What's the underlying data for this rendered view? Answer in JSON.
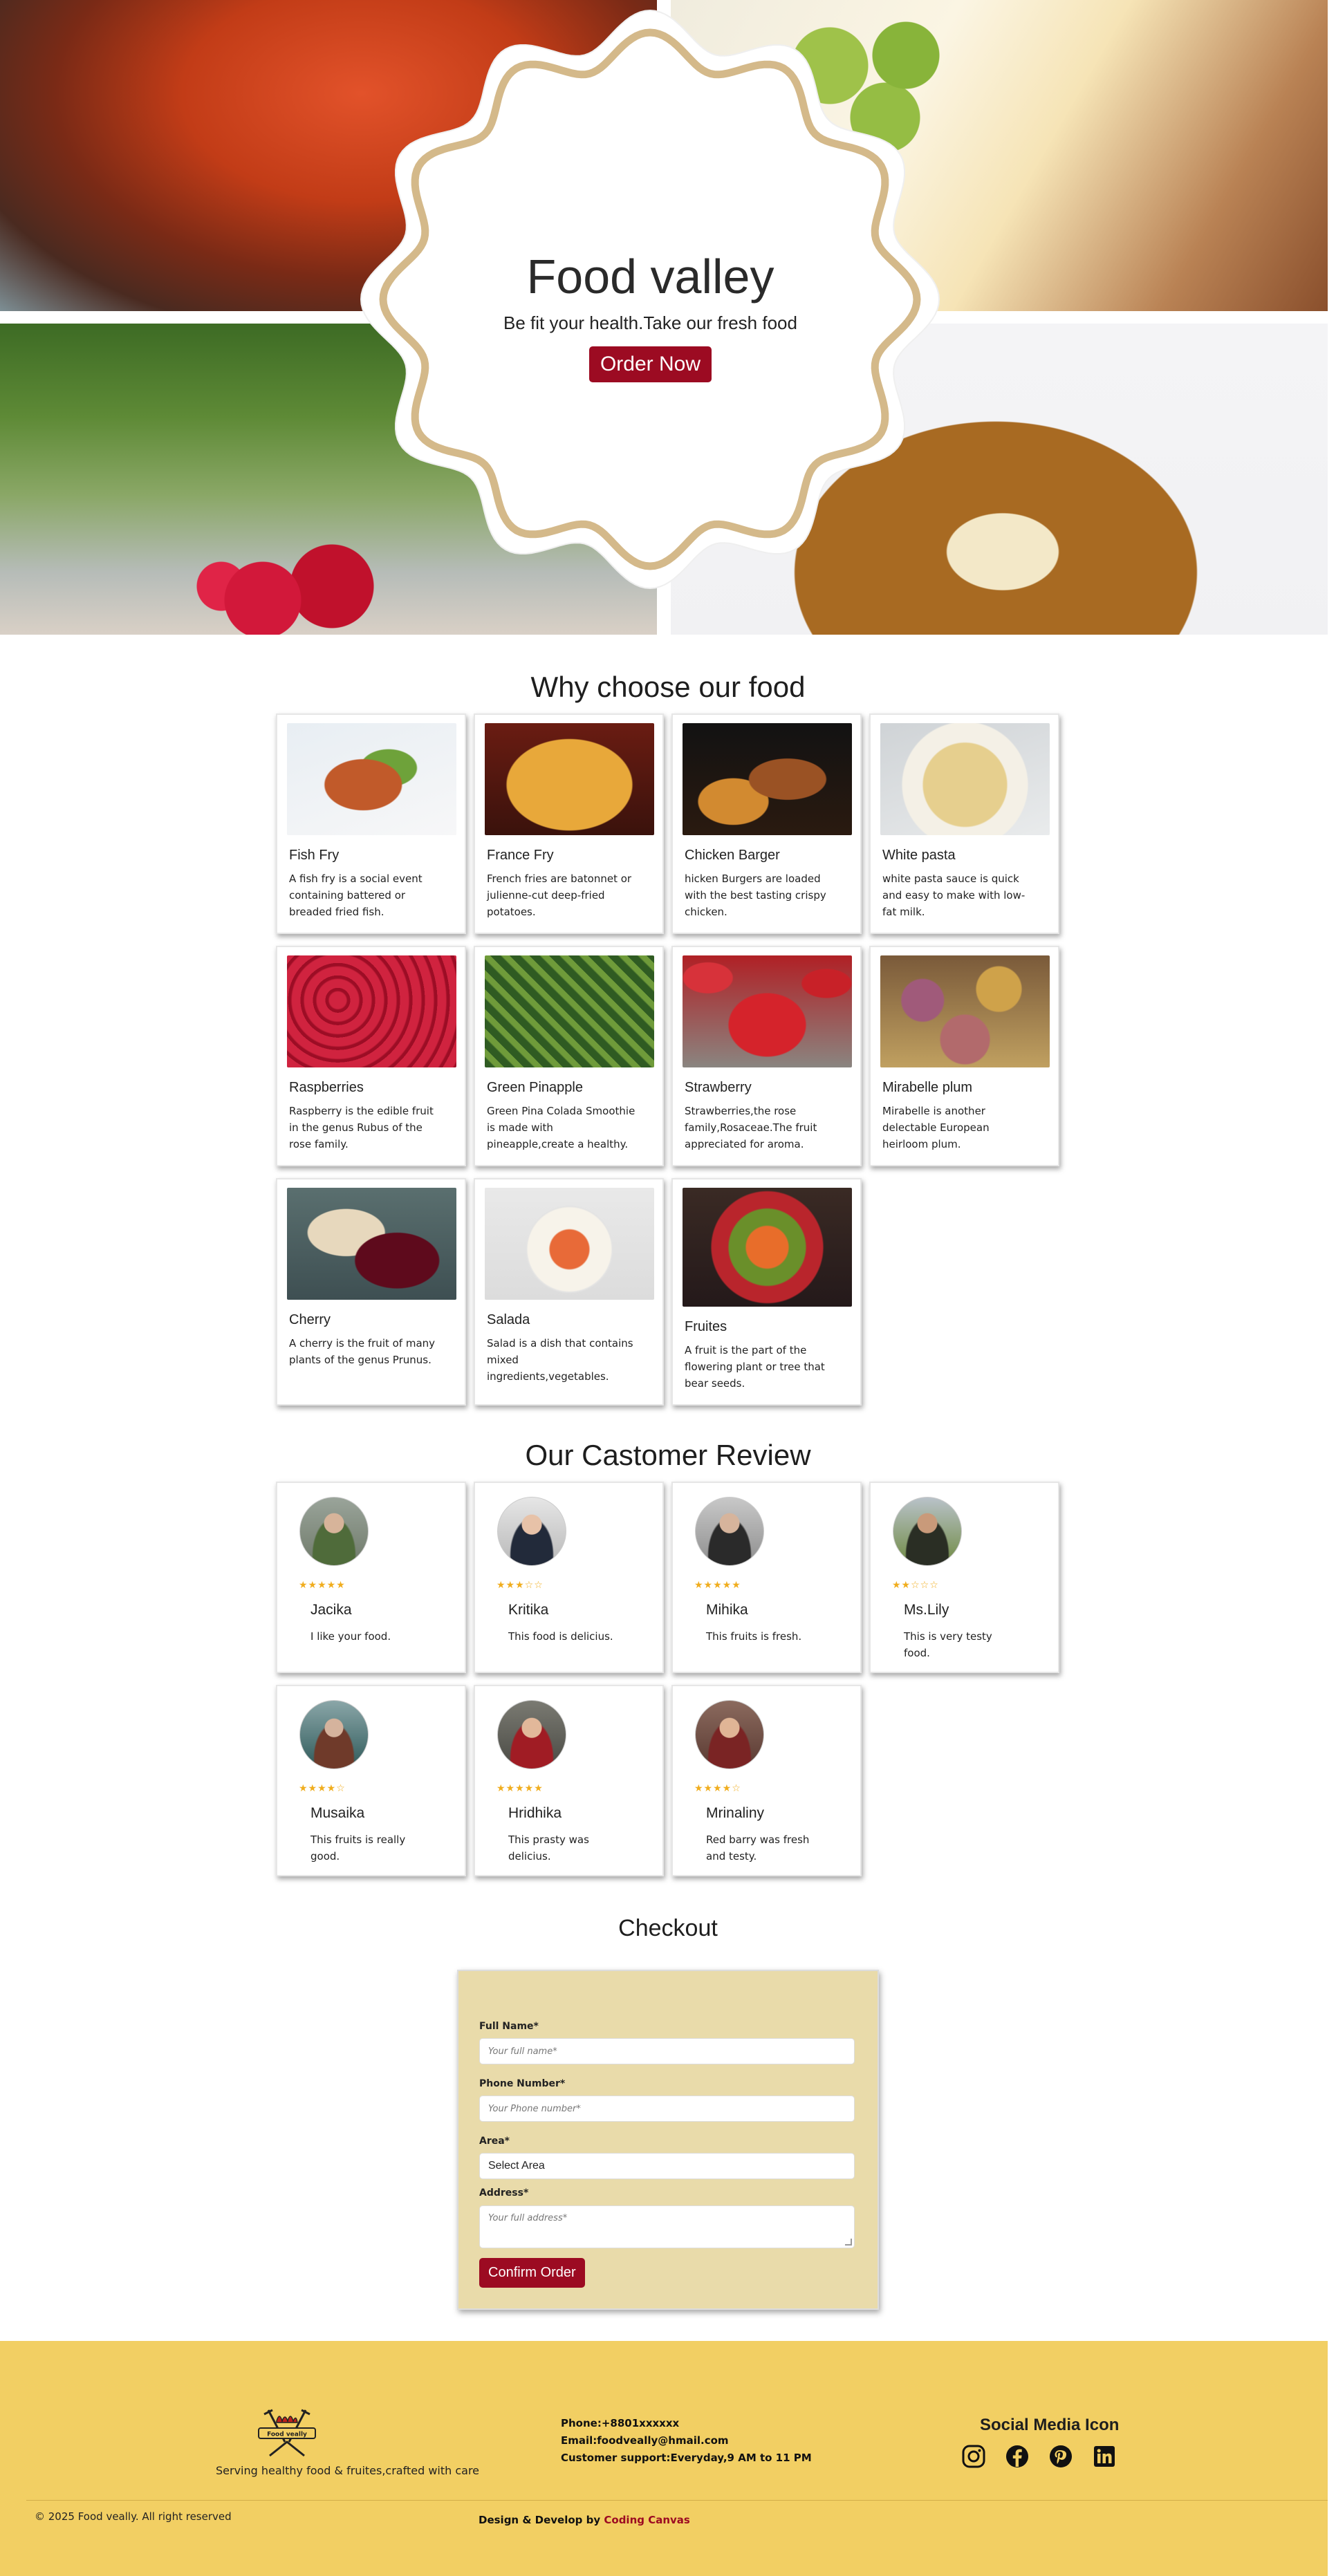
{
  "hero": {
    "title": "Food valley",
    "subtitle": "Be fit your health.Take our fresh food",
    "order_button": "Order Now"
  },
  "why": {
    "title": "Why choose our food",
    "items": [
      {
        "name": "Fish Fry",
        "desc": "A fish fry is a social event containing battered or breaded fried fish."
      },
      {
        "name": "France Fry",
        "desc": "French fries are batonnet or julienne-cut deep-fried potatoes."
      },
      {
        "name": "Chicken Barger",
        "desc": "hicken Burgers are loaded with the best tasting crispy chicken."
      },
      {
        "name": "White pasta",
        "desc": "white pasta sauce is quick and easy to make with low-fat milk."
      },
      {
        "name": "Raspberries",
        "desc": "Raspberry is the edible fruit in the genus Rubus of the rose family."
      },
      {
        "name": "Green Pinapple",
        "desc": "Green Pina Colada Smoothie is made with pineapple,create a healthy."
      },
      {
        "name": "Strawberry",
        "desc": "Strawberries,the rose family,Rosaceae.The fruit appreciated for aroma."
      },
      {
        "name": "Mirabelle plum",
        "desc": "Mirabelle is another delectable European heirloom plum."
      },
      {
        "name": "Cherry",
        "desc": "A cherry is the fruit of many plants of the genus Prunus."
      },
      {
        "name": "Salada",
        "desc": "Salad is a dish that contains mixed ingredients,vegetables."
      },
      {
        "name": "Fruites",
        "desc": "A fruit is the part of the flowering plant or tree that bear seeds."
      }
    ]
  },
  "reviews": {
    "title": "Our Castomer Review",
    "items": [
      {
        "name": "Jacika",
        "stars": "★★★★★",
        "text": "I like your food."
      },
      {
        "name": "Kritika",
        "stars": "★★★☆☆",
        "text": "This food is delicius."
      },
      {
        "name": "Mihika",
        "stars": "★★★★★",
        "text": "This fruits is fresh."
      },
      {
        "name": "Ms.Lily",
        "stars": "★★☆☆☆",
        "text": "This is very testy food."
      },
      {
        "name": "Musaika",
        "stars": "★★★★☆",
        "text": "This fruits is really good."
      },
      {
        "name": "Hridhika",
        "stars": "★★★★★",
        "text": "This prasty was delicius."
      },
      {
        "name": "Mrinaliny",
        "stars": "★★★★☆",
        "text": "Red barry was fresh and testy."
      }
    ]
  },
  "checkout": {
    "title": "Checkout",
    "full_name_label": "Full Name*",
    "full_name_placeholder": "Your full name*",
    "phone_label": "Phone Number*",
    "phone_placeholder": "Your Phone number*",
    "area_label": "Area*",
    "area_value": "Select Area",
    "address_label": "Address*",
    "address_placeholder": "Your full address*",
    "confirm_button": "Confirm Order"
  },
  "footer": {
    "logo_text": "Food veally",
    "tagline": "Serving healthy food & fruites,crafted with care",
    "phone": "Phone:+8801xxxxxx",
    "email": "Email:foodveally@hmail.com",
    "support": "Customer support:Everyday,9 AM to 11 PM",
    "social_title": "Social Media Icon",
    "social_icons": [
      "instagram-icon",
      "facebook-icon",
      "pinterest-icon",
      "linkedin-icon"
    ],
    "copyright": "© 2025 Food veally. All right reserved",
    "credit_prefix": "Design & Develop by",
    "credit_brand": "Coding Canvas"
  },
  "colors": {
    "accent": "#9c0b22",
    "footer_bg": "#f2cf63",
    "checkout_bg": "#e9dbaa",
    "star": "#f0ad1e"
  }
}
